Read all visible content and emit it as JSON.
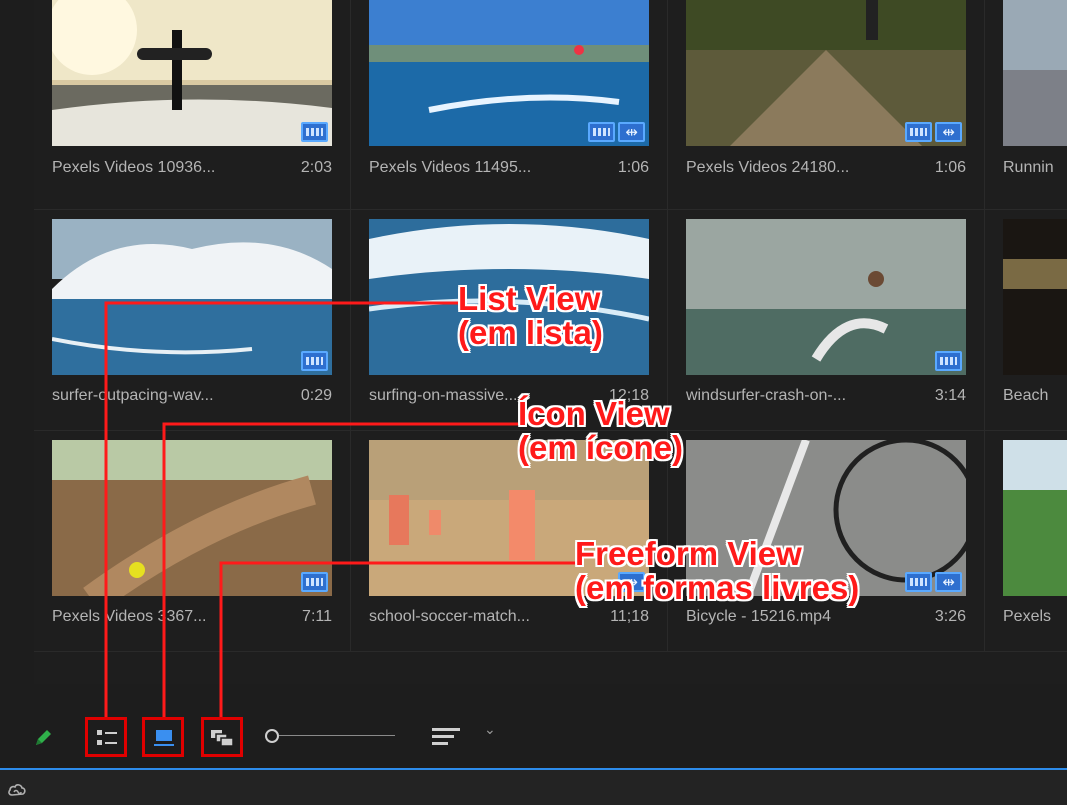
{
  "tiles": [
    {
      "name": "Pexels Videos 10936...",
      "duration": "2:03",
      "badges": [
        "video"
      ],
      "scene": "surfer-sunset"
    },
    {
      "name": "Pexels Videos 11495...",
      "duration": "1:06",
      "badges": [
        "video",
        "audio"
      ],
      "scene": "parasail-sea"
    },
    {
      "name": "Pexels Videos 24180...",
      "duration": "1:06",
      "badges": [
        "video",
        "audio"
      ],
      "scene": "forest-bike"
    },
    {
      "name": "Runnin",
      "duration": "",
      "badges": [],
      "scene": "runner-street"
    },
    {
      "name": "surfer-outpacing-wav...",
      "duration": "0:29",
      "badges": [
        "video"
      ],
      "scene": "big-wave"
    },
    {
      "name": "surfing-on-massive...",
      "duration": "12;18",
      "badges": [],
      "scene": "massive-wave"
    },
    {
      "name": "windsurfer-crash-on-...",
      "duration": "3:14",
      "badges": [
        "video"
      ],
      "scene": "kitesurfer"
    },
    {
      "name": "Beach",
      "duration": "",
      "badges": [],
      "scene": "beach-dark"
    },
    {
      "name": "Pexels Videos 3367...",
      "duration": "7:11",
      "badges": [
        "video"
      ],
      "scene": "dirt-track"
    },
    {
      "name": "school-soccer-match...",
      "duration": "11;18",
      "badges": [
        "audio"
      ],
      "scene": "soccer-kids"
    },
    {
      "name": "Bicycle - 15216.mp4",
      "duration": "3:26",
      "badges": [
        "video",
        "audio"
      ],
      "scene": "bicycle-wheel"
    },
    {
      "name": "Pexels",
      "duration": "",
      "badges": [],
      "scene": "green-field"
    }
  ],
  "toolbar": {
    "pencil_icon": "pencil-icon",
    "list_view_icon": "list-view-icon",
    "icon_view_icon": "icon-view-icon",
    "freeform_view_icon": "freeform-view-icon",
    "zoom_slider_value": 0,
    "sort_icon": "sort-icon",
    "chevron": "⌄"
  },
  "annotations": {
    "list_view": [
      "List View",
      "(em lista)"
    ],
    "icon_view": [
      "Ícon View",
      "(em ícone)"
    ],
    "freeform_view": [
      "Freeform View",
      "(em formas livres)"
    ]
  },
  "colors": {
    "annotation": "#e00000",
    "accent": "#2d8ceb",
    "badge": "#2e6fcf"
  },
  "status_icon": "creative-cloud-icon"
}
